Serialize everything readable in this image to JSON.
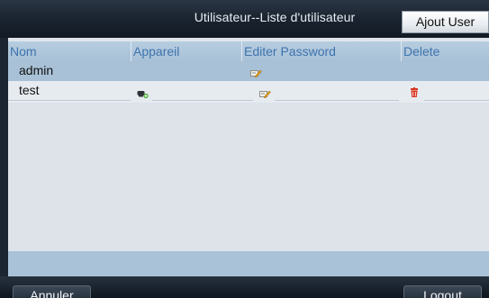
{
  "window": {
    "title": "Utilisateur--Liste d'utilisateur",
    "add_button": "Ajout User"
  },
  "table": {
    "columns": [
      "Nom",
      "Appareil",
      "Editer Password",
      "Delete"
    ],
    "rows": [
      {
        "name": "admin",
        "device_icon": null,
        "edit_icon": "edit-password-icon",
        "delete_icon": null
      },
      {
        "name": "test",
        "device_icon": "device-permission-icon",
        "edit_icon": "edit-password-icon",
        "delete_icon": "trash-icon"
      }
    ]
  },
  "footer": {
    "cancel_label": "Annuler",
    "logout_label": "Logout"
  },
  "colors": {
    "header_text": "#3e73ad",
    "selected_row": "#a8c1d6",
    "delete_red": "#d9341f"
  }
}
